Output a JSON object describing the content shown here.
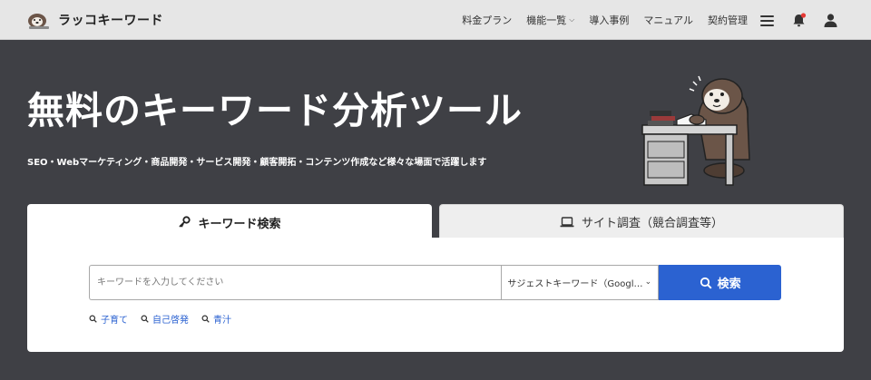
{
  "header": {
    "logo_text": "ラッコキーワード",
    "nav": [
      {
        "label": "料金プラン",
        "dropdown": false
      },
      {
        "label": "機能一覧",
        "dropdown": true
      },
      {
        "label": "導入事例",
        "dropdown": false
      },
      {
        "label": "マニュアル",
        "dropdown": false
      },
      {
        "label": "契約管理",
        "dropdown": false
      }
    ],
    "icons": [
      "menu-icon",
      "bell-icon",
      "user-icon"
    ],
    "notification_color": "#e53935"
  },
  "hero": {
    "title": "無料のキーワード分析ツール",
    "subtitle": "SEO・Webマーケティング・商品開発・サービス開発・顧客開拓・コンテンツ作成など様々な場面で活躍します"
  },
  "tabs": [
    {
      "label": "キーワード検索",
      "icon": "key-icon",
      "active": true
    },
    {
      "label": "サイト調査（競合調査等）",
      "icon": "laptop-icon",
      "active": false
    }
  ],
  "search": {
    "placeholder": "キーワードを入力してください",
    "select_value": "サジェストキーワード（Google）",
    "button_label": "検索",
    "accent_color": "#2b62d1"
  },
  "suggestions": [
    "子育て",
    "自己啓発",
    "青汁"
  ]
}
